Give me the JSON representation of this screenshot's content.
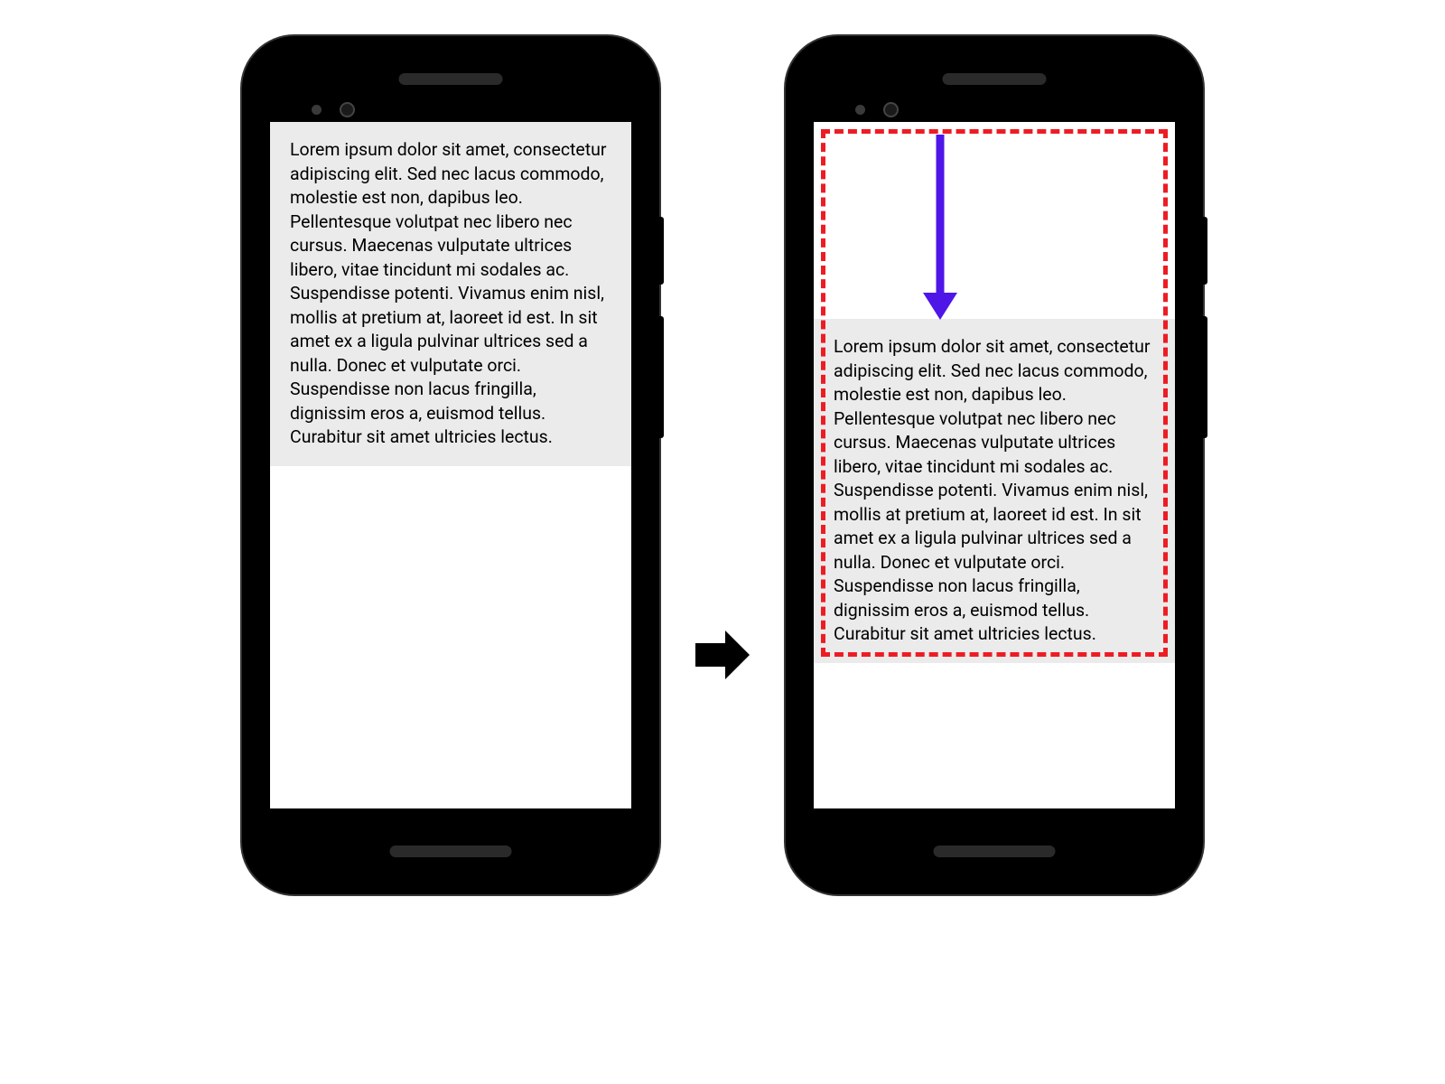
{
  "left_phone": {
    "text": "Lorem ipsum dolor sit amet, consectetur adipiscing elit. Sed nec lacus commodo, molestie est non, dapibus leo. Pellentesque volutpat nec libero nec cursus. Maecenas vulputate ultrices libero, vitae tincidunt mi sodales ac. Suspendisse potenti. Vivamus enim nisl, mollis at pretium at, laoreet id est. In sit amet ex a ligula pulvinar ultrices sed a nulla. Donec et vulputate orci. Suspendisse non lacus fringilla, dignissim eros a, euismod tellus. Curabitur sit amet ultricies lectus."
  },
  "right_phone": {
    "text": "Lorem ipsum dolor sit amet, consectetur adipiscing elit. Sed nec lacus commodo, molestie est non, dapibus leo. Pellentesque volutpat nec libero nec cursus. Maecenas vulputate ultrices libero, vitae tincidunt mi sodales ac. Suspendisse potenti. Vivamus enim nisl, mollis at pretium at, laoreet id est. In sit amet ex a ligula pulvinar ultrices sed a nulla. Donec et vulputate orci. Suspendisse non lacus fringilla, dignissim eros a, euismod tellus. Curabitur sit amet ultricies lectus."
  },
  "colors": {
    "dashed_border": "#ed1c24",
    "arrow": "#4f16e8",
    "text_box_bg": "#ebebeb"
  }
}
